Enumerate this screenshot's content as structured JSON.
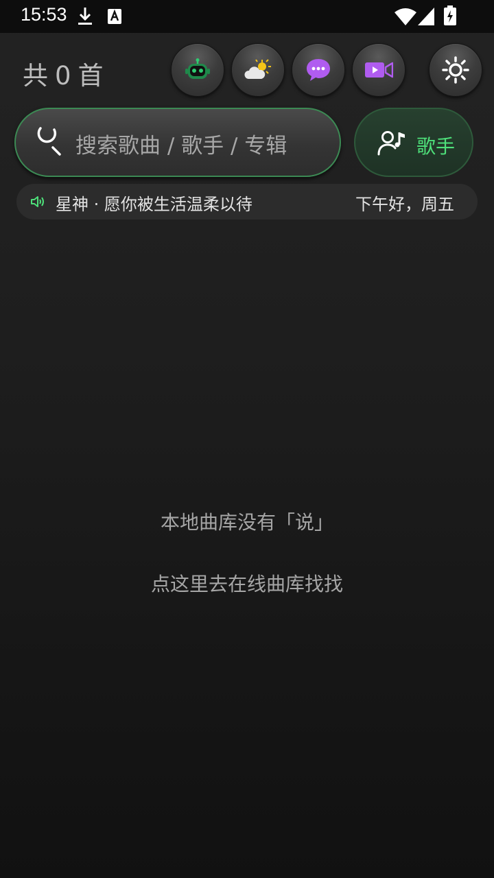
{
  "status_bar": {
    "time": "15:53",
    "icons": [
      "download-icon",
      "font-notification-icon",
      "wifi-icon",
      "cell-signal-icon",
      "battery-charging-icon"
    ]
  },
  "header": {
    "count_prefix": "共",
    "count": "0",
    "count_suffix": "首",
    "buttons": [
      {
        "name": "robot-button",
        "icon": "robot-icon"
      },
      {
        "name": "weather-button",
        "icon": "weather-icon"
      },
      {
        "name": "chat-button",
        "icon": "chat-bubble-icon"
      },
      {
        "name": "video-button",
        "icon": "video-camera-icon"
      },
      {
        "name": "settings-button",
        "icon": "gear-icon"
      }
    ]
  },
  "search": {
    "placeholder": "搜索歌曲 / 歌手 / 专辑",
    "icon": "search-icon"
  },
  "singer_button": {
    "label": "歌手",
    "icon": "singer-icon"
  },
  "ticker": {
    "icon": "speaker-icon",
    "text": "星神 · 愿你被生活温柔以待",
    "greeting": "下午好，周五"
  },
  "empty_state": {
    "line1": "本地曲库没有「说」",
    "line2": "点这里去在线曲库找找"
  },
  "colors": {
    "accent_green": "#4ee07a",
    "robot_green": "#2ecc71",
    "chat_purple": "#b05cf0",
    "video_purple": "#b05cf0",
    "sun_yellow": "#f5c518"
  }
}
